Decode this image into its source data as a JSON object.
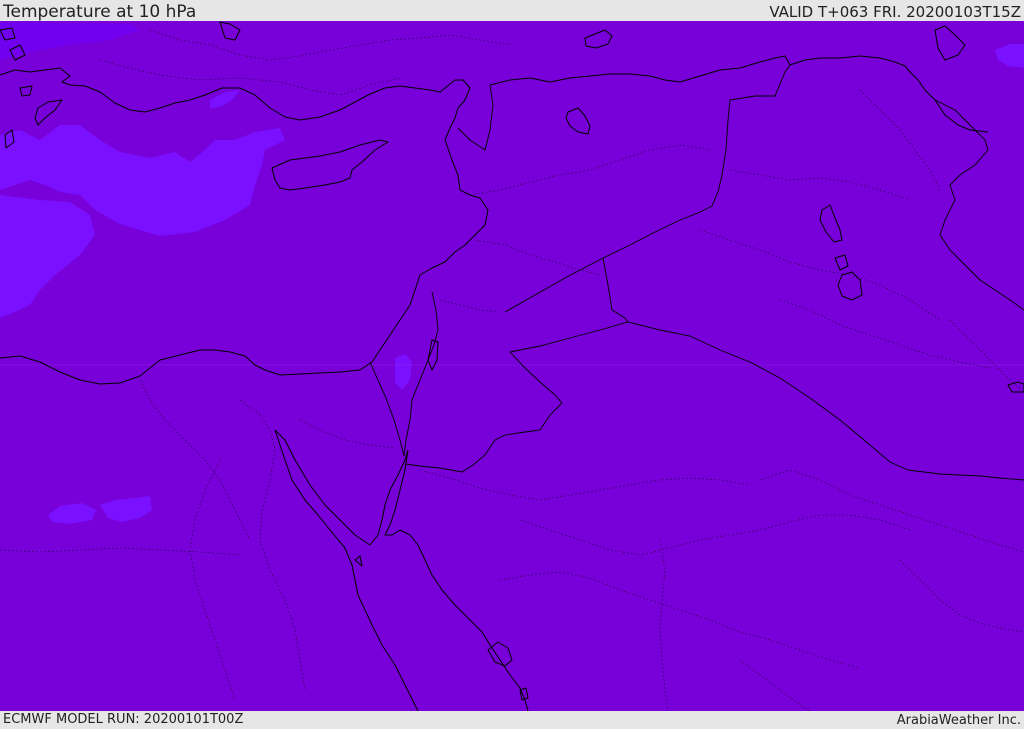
{
  "header": {
    "title": "Temperature at 10 hPa",
    "valid": "VALID T+063 FRI. 20200103T15Z"
  },
  "footer": {
    "model_run": "ECMWF MODEL RUN: 20200101T00Z",
    "credit": "ArabiaWeather Inc."
  },
  "colors": {
    "field_main": "#7800d8",
    "field_warm_patch": "#7200f0",
    "field_light_patch": "#7a10ff",
    "coastline": "#000000",
    "frame": "#e6e6e6"
  }
}
